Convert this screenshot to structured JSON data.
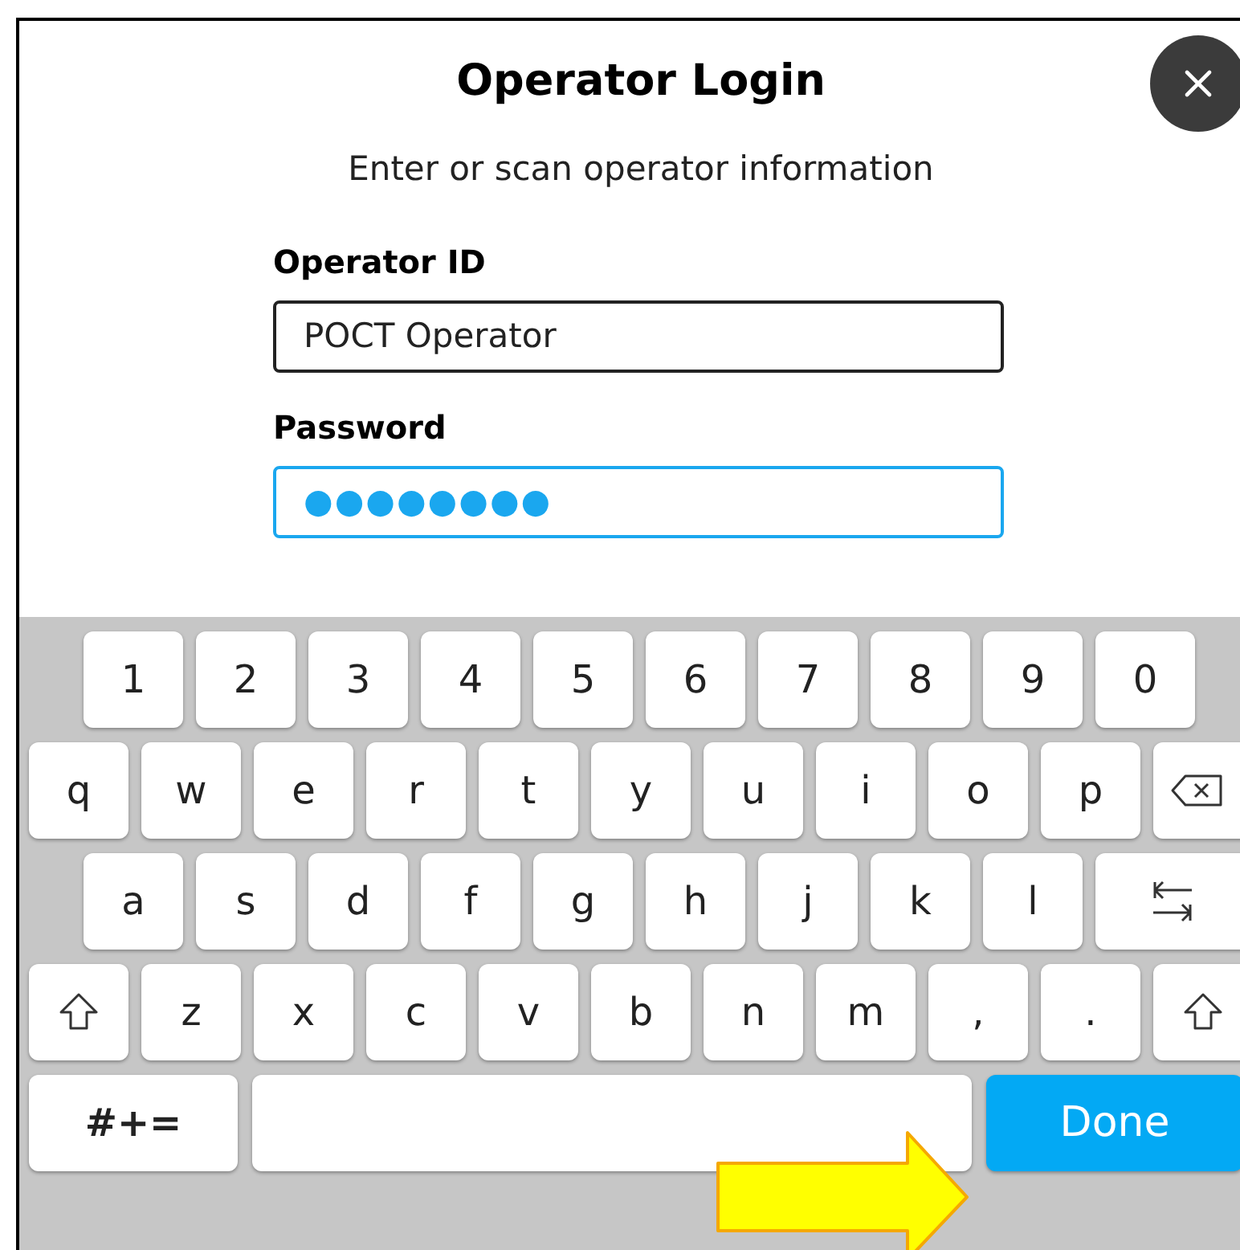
{
  "dialog": {
    "title": "Operator Login",
    "subtitle": "Enter or scan operator information"
  },
  "fields": [
    {
      "label": "Operator ID",
      "value": "POCT Operator",
      "focused": false
    },
    {
      "label": "Password",
      "value": "●●●●●●●●",
      "focused": true
    }
  ],
  "keyboard": {
    "rows": [
      {
        "keys": [
          {
            "kind": "char",
            "label": "1"
          },
          {
            "kind": "char",
            "label": "2"
          },
          {
            "kind": "char",
            "label": "3"
          },
          {
            "kind": "char",
            "label": "4"
          },
          {
            "kind": "char",
            "label": "5"
          },
          {
            "kind": "char",
            "label": "6"
          },
          {
            "kind": "char",
            "label": "7"
          },
          {
            "kind": "char",
            "label": "8"
          },
          {
            "kind": "char",
            "label": "9"
          },
          {
            "kind": "char",
            "label": "0"
          }
        ]
      },
      {
        "keys": [
          {
            "kind": "char",
            "label": "q"
          },
          {
            "kind": "char",
            "label": "w"
          },
          {
            "kind": "char",
            "label": "e"
          },
          {
            "kind": "char",
            "label": "r"
          },
          {
            "kind": "char",
            "label": "t"
          },
          {
            "kind": "char",
            "label": "y"
          },
          {
            "kind": "char",
            "label": "u"
          },
          {
            "kind": "char",
            "label": "i"
          },
          {
            "kind": "char",
            "label": "o"
          },
          {
            "kind": "char",
            "label": "p"
          },
          {
            "kind": "backspace"
          }
        ]
      },
      {
        "keys": [
          {
            "kind": "char",
            "label": "a"
          },
          {
            "kind": "char",
            "label": "s"
          },
          {
            "kind": "char",
            "label": "d"
          },
          {
            "kind": "char",
            "label": "f"
          },
          {
            "kind": "char",
            "label": "g"
          },
          {
            "kind": "char",
            "label": "h"
          },
          {
            "kind": "char",
            "label": "j"
          },
          {
            "kind": "char",
            "label": "k"
          },
          {
            "kind": "char",
            "label": "l"
          },
          {
            "kind": "tab"
          }
        ]
      },
      {
        "keys": [
          {
            "kind": "shift"
          },
          {
            "kind": "char",
            "label": "z"
          },
          {
            "kind": "char",
            "label": "x"
          },
          {
            "kind": "char",
            "label": "c"
          },
          {
            "kind": "char",
            "label": "v"
          },
          {
            "kind": "char",
            "label": "b"
          },
          {
            "kind": "char",
            "label": "n"
          },
          {
            "kind": "char",
            "label": "m"
          },
          {
            "kind": "char",
            "label": ","
          },
          {
            "kind": "char",
            "label": "."
          },
          {
            "kind": "shift"
          }
        ]
      },
      {
        "keys": [
          {
            "kind": "symbols",
            "label": "#+="
          },
          {
            "kind": "space"
          },
          {
            "kind": "done",
            "label": "Done"
          }
        ]
      }
    ]
  }
}
